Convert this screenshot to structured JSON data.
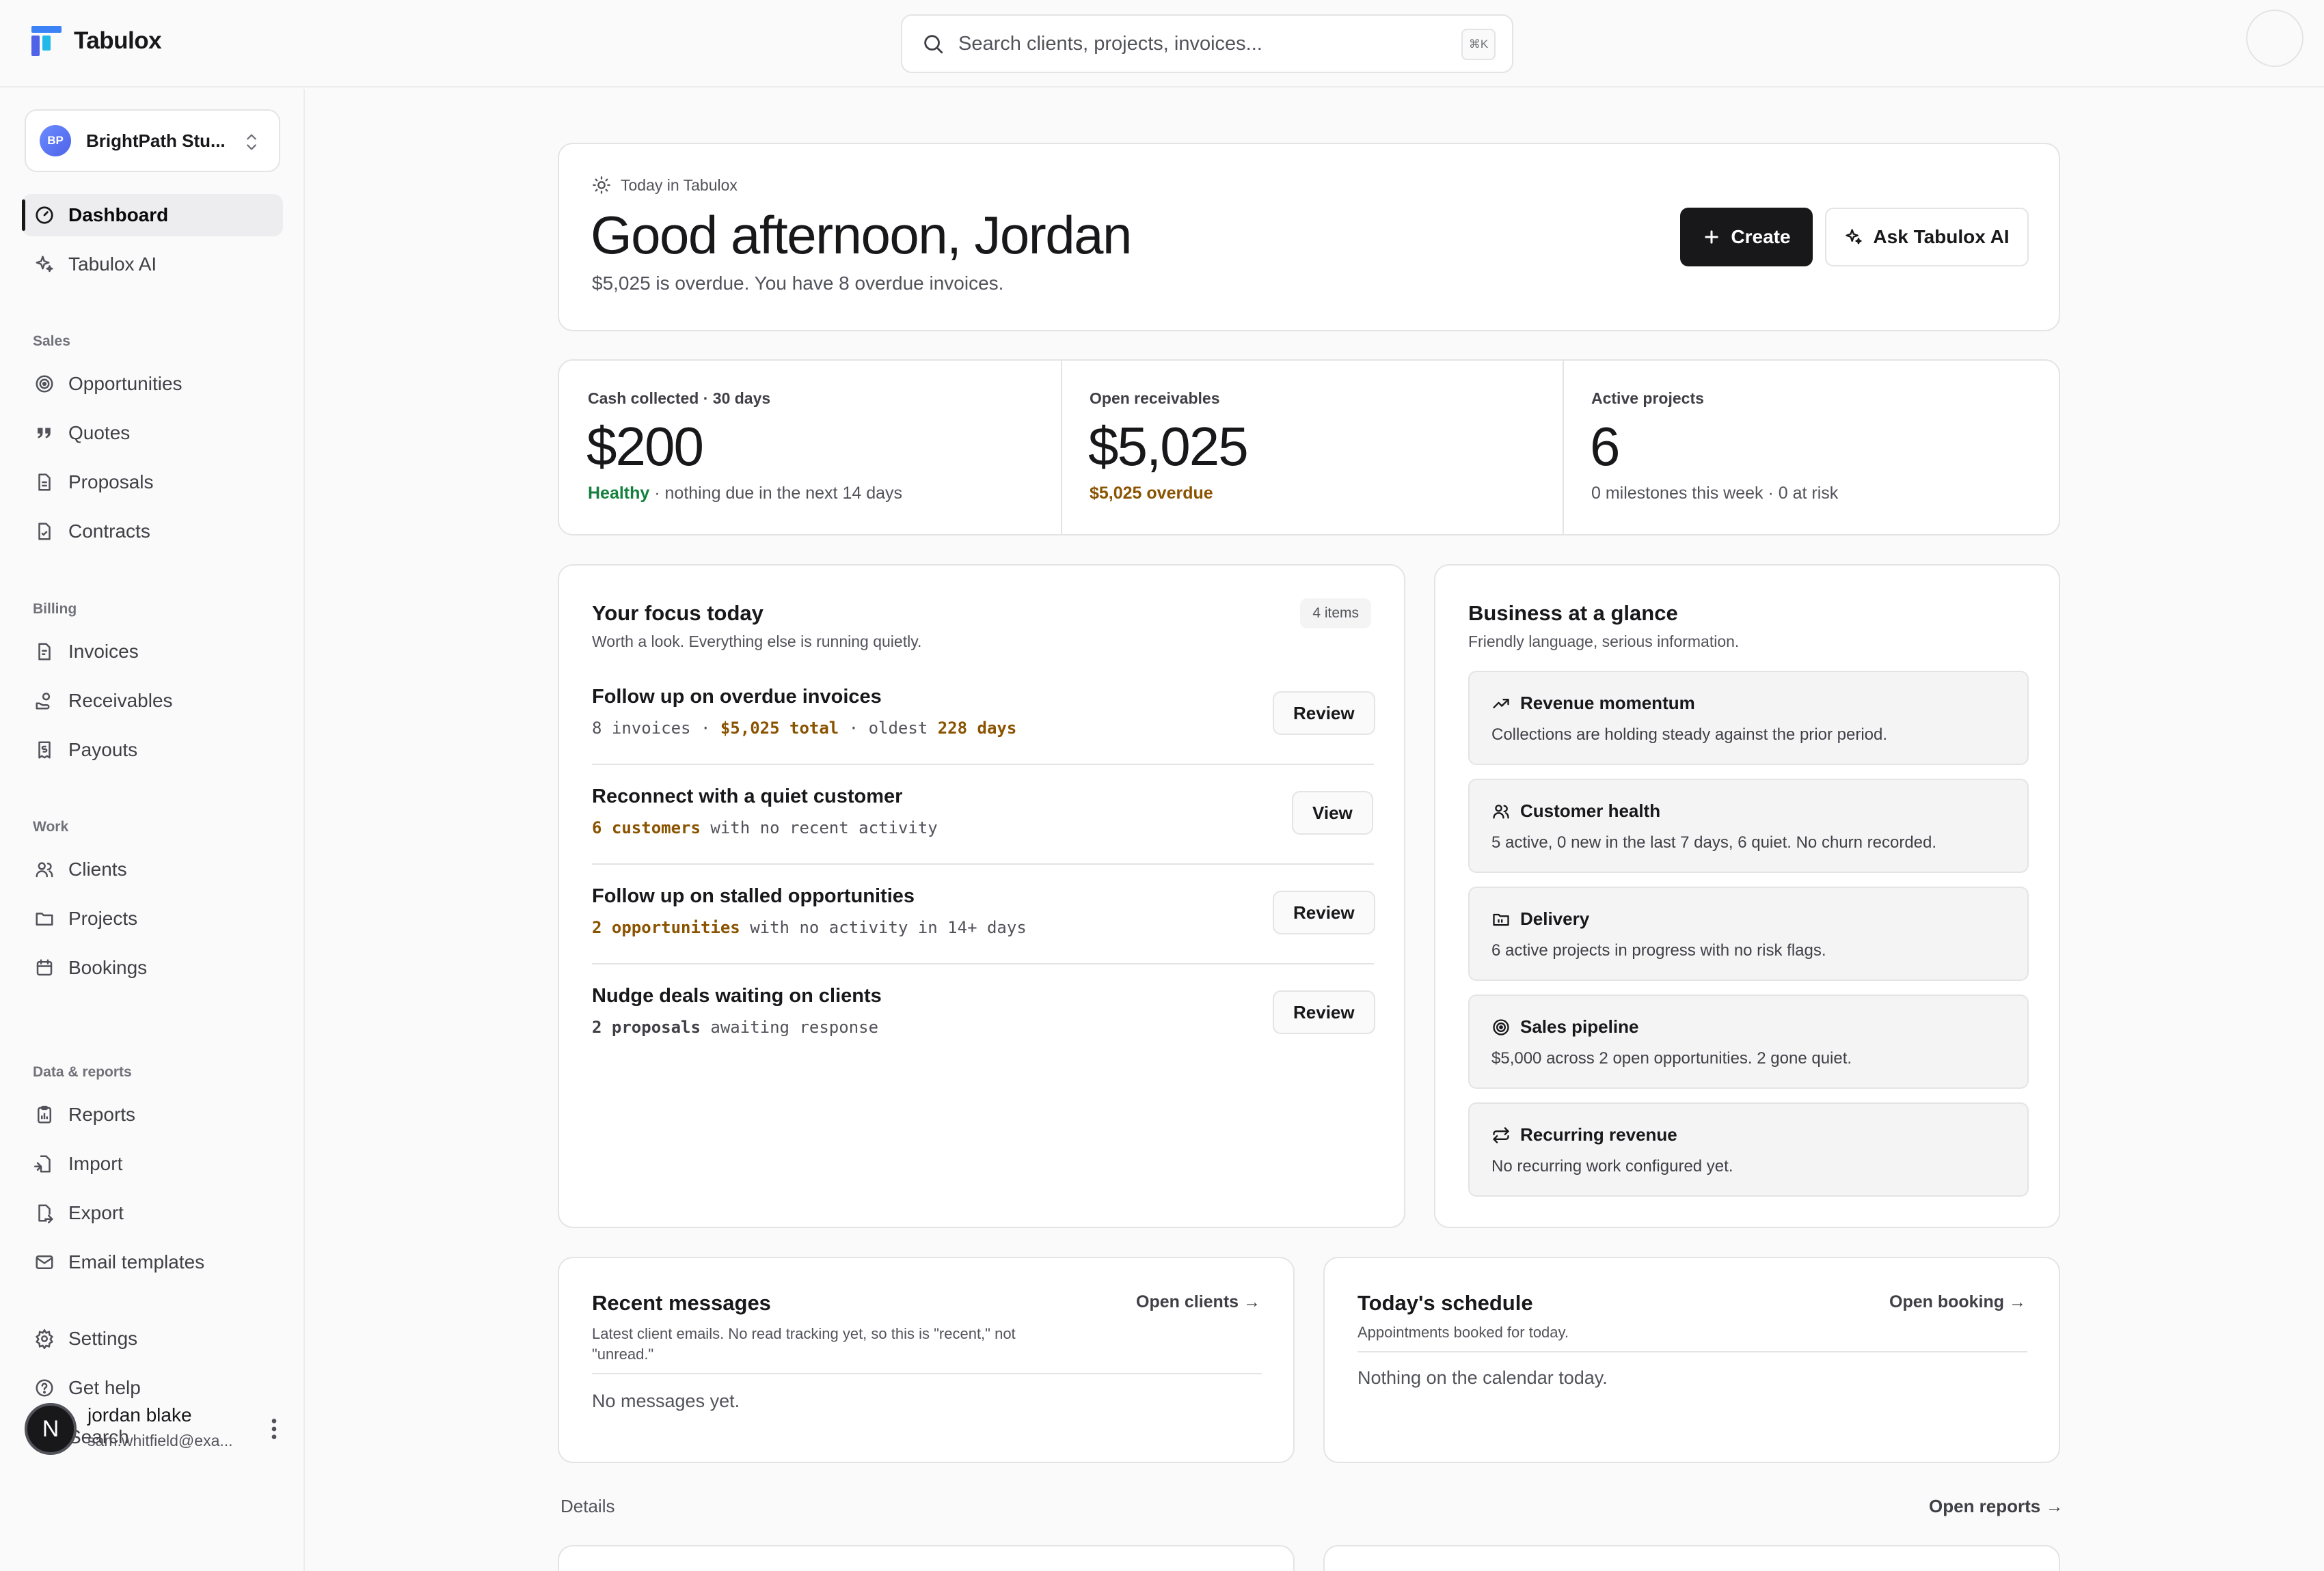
{
  "app": {
    "name": "Tabulox"
  },
  "search": {
    "placeholder": "Search clients, projects, invoices...",
    "shortcut": "⌘K"
  },
  "workspace": {
    "initials": "BP",
    "name": "BrightPath Stu..."
  },
  "nav": {
    "dashboard": "Dashboard",
    "ai": "Tabulox AI",
    "sales_heading": "Sales",
    "opportunities": "Opportunities",
    "quotes": "Quotes",
    "proposals": "Proposals",
    "contracts": "Contracts",
    "billing_heading": "Billing",
    "invoices": "Invoices",
    "receivables": "Receivables",
    "payouts": "Payouts",
    "work_heading": "Work",
    "clients": "Clients",
    "projects": "Projects",
    "bookings": "Bookings",
    "data_heading": "Data & reports",
    "reports": "Reports",
    "import": "Import",
    "export": "Export",
    "email_templates": "Email templates",
    "settings": "Settings",
    "help": "Get help",
    "search": "Search"
  },
  "user": {
    "initial": "N",
    "name": "jordan blake",
    "email": "sam.whitfield@exa..."
  },
  "hero": {
    "eyebrow": "Today in Tabulox",
    "greeting": "Good afternoon, Jordan",
    "summary": "$5,025 is overdue. You have 8 overdue invoices.",
    "create_label": "Create",
    "ai_label": "Ask Tabulox AI"
  },
  "stats": [
    {
      "label": "Cash collected · 30 days",
      "value": "$200",
      "status": "Healthy",
      "note": " · nothing due in the next 14 days"
    },
    {
      "label": "Open receivables",
      "value": "$5,025",
      "status": "$5,025 overdue",
      "note": ""
    },
    {
      "label": "Active projects",
      "value": "6",
      "status": "",
      "note": "0 milestones this week · 0 at risk"
    }
  ],
  "focus": {
    "title": "Your focus today",
    "subtitle": "Worth a look. Everything else is running quietly.",
    "count": "4 items",
    "items": [
      {
        "title": "Follow up on overdue invoices",
        "d1": "8 invoices · ",
        "h1": "$5,025 total",
        "d2": " · oldest ",
        "h2": "228 days",
        "action": "Review"
      },
      {
        "title": "Reconnect with a quiet customer",
        "h1": "6 customers",
        "d1": " with no recent activity",
        "action": "View"
      },
      {
        "title": "Follow up on stalled opportunities",
        "h1": "2 opportunities",
        "d1": " with no activity in 14+ days",
        "action": "Review"
      },
      {
        "title": "Nudge deals waiting on clients",
        "h1": "2 proposals",
        "d1": " awaiting response",
        "action": "Review"
      }
    ]
  },
  "glance": {
    "title": "Business at a glance",
    "subtitle": "Friendly language, serious information.",
    "items": [
      {
        "icon": "trending-up-icon",
        "title": "Revenue momentum",
        "body": "Collections are holding steady against the prior period."
      },
      {
        "icon": "users-icon",
        "title": "Customer health",
        "body": "5 active, 0 new in the last 7 days, 6 quiet. No churn recorded."
      },
      {
        "icon": "folder-icon",
        "title": "Delivery",
        "body": "6 active projects in progress with no risk flags."
      },
      {
        "icon": "target-icon",
        "title": "Sales pipeline",
        "body": "$5,000 across 2 open opportunities. 2 gone quiet."
      },
      {
        "icon": "repeat-icon",
        "title": "Recurring revenue",
        "body": "No recurring work configured yet."
      }
    ]
  },
  "messages": {
    "title": "Recent messages",
    "link": "Open clients →",
    "subtitle_1": "Latest client emails. No read tracking yet, so this is \"recent,\" not",
    "subtitle_2": "\"unread.\"",
    "empty": "No messages yet."
  },
  "schedule": {
    "title": "Today's schedule",
    "link": "Open booking →",
    "subtitle": "Appointments booked for today.",
    "empty": "Nothing on the calendar today."
  },
  "details": {
    "label": "Details",
    "link": "Open reports →"
  },
  "colors": {
    "accent": "#18181b",
    "healthy": "#15803d",
    "warning": "#8a5300",
    "brand_blue": "#4f63e8"
  }
}
